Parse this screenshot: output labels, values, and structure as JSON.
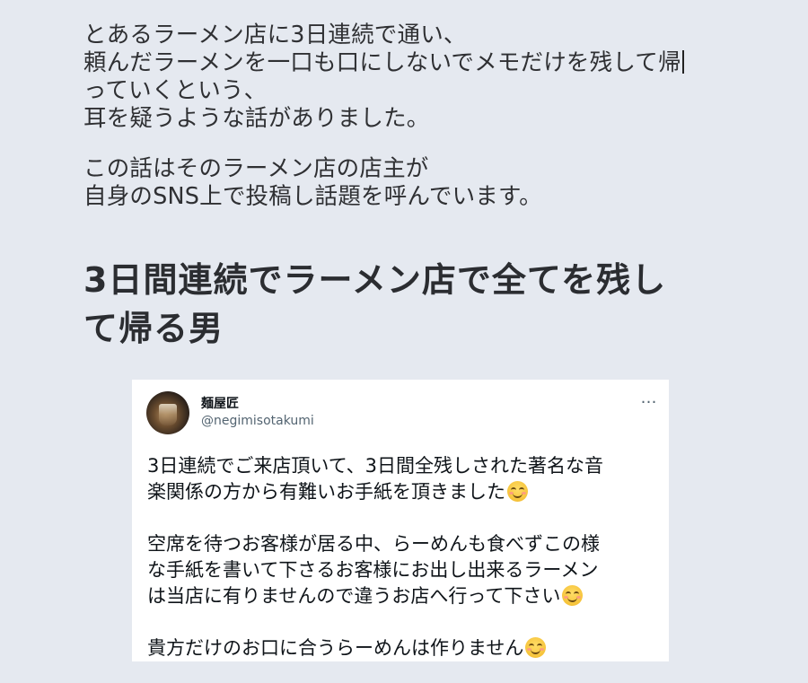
{
  "article": {
    "paragraph1": [
      "とあるラーメン店に3日連続で通い、",
      "頼んだラーメンを一口も口にしないでメモだけを残して帰",
      "っていくという、",
      "耳を疑うような話がありました。"
    ],
    "paragraph2": [
      "この話はそのラーメン店の店主が",
      "自身のSNS上で投稿し話題を呼んでいます。"
    ],
    "headline": [
      "3日間連続でラーメン店で全てを残し",
      "て帰る男"
    ]
  },
  "tweet": {
    "display_name": "麺屋匠",
    "handle": "@negimisotakumi",
    "more_icon": "…",
    "body": {
      "block1": [
        "3日連続でご来店頂いて、3日間全残しされた著名な音",
        "楽関係の方から有難いお手紙を頂きました"
      ],
      "block2": [
        "空席を待つお客様が居る中、らーめんも食べずこの様",
        "な手紙を書いて下さるお客様にお出し出来るラーメン",
        "は当店に有りませんので違うお店へ行って下さい"
      ],
      "block3": [
        "貴方だけのお口に合うらーめんは作りません"
      ]
    },
    "emoji_name": "smiling-face-with-smiling-eyes-emoji"
  },
  "colors": {
    "page_background": "#e5e9f0",
    "tweet_background": "#ffffff",
    "tweet_text": "#0f1419",
    "handle_text": "#536471"
  }
}
